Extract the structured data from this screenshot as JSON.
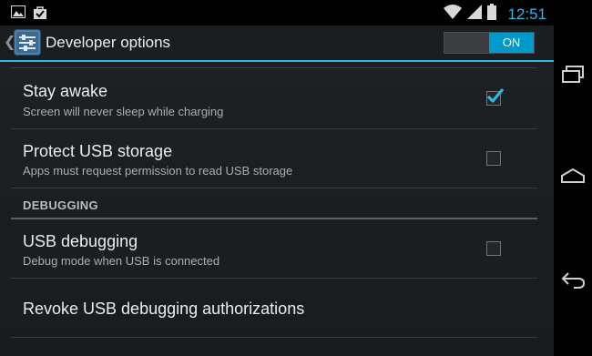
{
  "status_bar": {
    "notification_icons": [
      "gallery-icon",
      "shopping-bag-icon"
    ],
    "system_icons": [
      "wifi-icon",
      "signal-icon",
      "battery-icon"
    ],
    "time": "12:51"
  },
  "action_bar": {
    "title": "Developer options",
    "icon": "developer-options-icon",
    "toggle_label": "ON",
    "toggle_on": true
  },
  "settings": {
    "stay_awake": {
      "title": "Stay awake",
      "summary": "Screen will never sleep while charging",
      "checked": true
    },
    "protect_usb": {
      "title": "Protect USB storage",
      "summary": "Apps must request permission to read USB storage",
      "checked": false
    },
    "debugging_category": "DEBUGGING",
    "usb_debugging": {
      "title": "USB debugging",
      "summary": "Debug mode when USB is connected",
      "checked": false
    },
    "revoke": {
      "title": "Revoke USB debugging authorizations"
    }
  },
  "nav_bar": [
    "recent-apps-icon",
    "home-icon",
    "back-icon"
  ],
  "colors": {
    "accent": "#33b5e5",
    "toggle_on": "#0099cc",
    "background": "#1e2225"
  }
}
